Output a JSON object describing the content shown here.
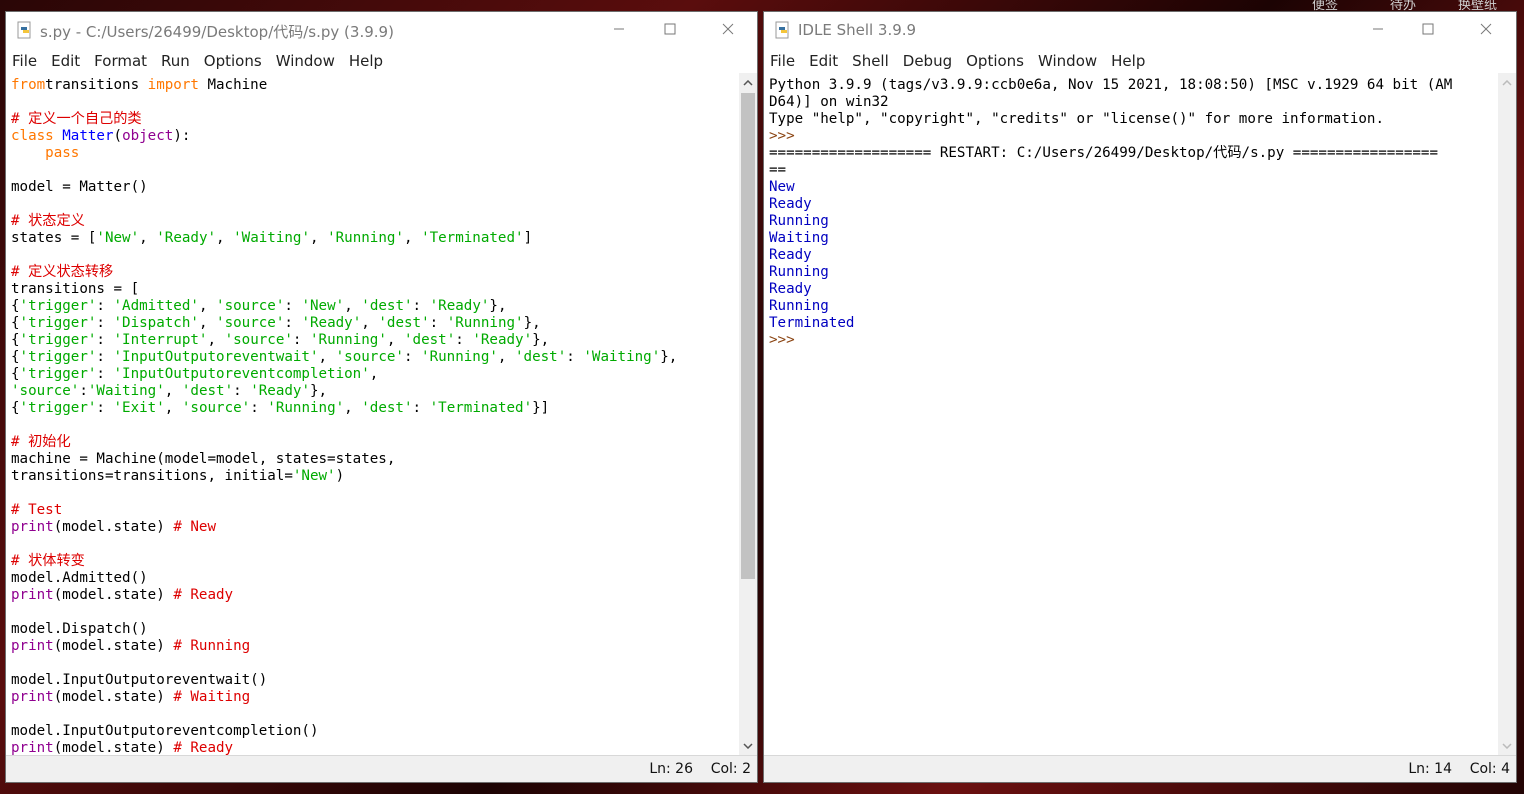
{
  "desktop": {
    "taskbar_hints": [
      "便签",
      "待办",
      "换壁纸"
    ]
  },
  "editor": {
    "title": "s.py - C:/Users/26499/Desktop/代码/s.py (3.9.9)",
    "menu": [
      "File",
      "Edit",
      "Format",
      "Run",
      "Options",
      "Window",
      "Help"
    ],
    "status": {
      "ln": "Ln: 26",
      "col": "Col: 2"
    },
    "code_lines": [
      [
        [
          "kw",
          "from"
        ],
        [
          "",
          "transitions "
        ],
        [
          "kw",
          "import"
        ],
        [
          "",
          " Machine"
        ]
      ],
      [],
      [
        [
          "cm",
          "# 定义一个自己的类"
        ]
      ],
      [
        [
          "kw",
          "class"
        ],
        [
          "",
          " "
        ],
        [
          "df",
          "Matter"
        ],
        [
          "",
          "("
        ],
        [
          "bi",
          "object"
        ],
        [
          "",
          "):"
        ]
      ],
      [
        [
          "",
          "    "
        ],
        [
          "kw",
          "pass"
        ]
      ],
      [],
      [
        [
          "",
          "model = Matter()"
        ]
      ],
      [],
      [
        [
          "cm",
          "# 状态定义"
        ]
      ],
      [
        [
          "",
          "states = ["
        ],
        [
          "st",
          "'New'"
        ],
        [
          "",
          ", "
        ],
        [
          "st",
          "'Ready'"
        ],
        [
          "",
          ", "
        ],
        [
          "st",
          "'Waiting'"
        ],
        [
          "",
          ", "
        ],
        [
          "st",
          "'Running'"
        ],
        [
          "",
          ", "
        ],
        [
          "st",
          "'Terminated'"
        ],
        [
          "",
          "]"
        ]
      ],
      [],
      [
        [
          "cm",
          "# 定义状态转移"
        ]
      ],
      [
        [
          "",
          "transitions = ["
        ]
      ],
      [
        [
          "",
          "{"
        ],
        [
          "st",
          "'trigger'"
        ],
        [
          "",
          ": "
        ],
        [
          "st",
          "'Admitted'"
        ],
        [
          "",
          ", "
        ],
        [
          "st",
          "'source'"
        ],
        [
          "",
          ": "
        ],
        [
          "st",
          "'New'"
        ],
        [
          "",
          ", "
        ],
        [
          "st",
          "'dest'"
        ],
        [
          "",
          ": "
        ],
        [
          "st",
          "'Ready'"
        ],
        [
          "",
          "},"
        ]
      ],
      [
        [
          "",
          "{"
        ],
        [
          "st",
          "'trigger'"
        ],
        [
          "",
          ": "
        ],
        [
          "st",
          "'Dispatch'"
        ],
        [
          "",
          ", "
        ],
        [
          "st",
          "'source'"
        ],
        [
          "",
          ": "
        ],
        [
          "st",
          "'Ready'"
        ],
        [
          "",
          ", "
        ],
        [
          "st",
          "'dest'"
        ],
        [
          "",
          ": "
        ],
        [
          "st",
          "'Running'"
        ],
        [
          "",
          "},"
        ]
      ],
      [
        [
          "",
          "{"
        ],
        [
          "st",
          "'trigger'"
        ],
        [
          "",
          ": "
        ],
        [
          "st",
          "'Interrupt'"
        ],
        [
          "",
          ", "
        ],
        [
          "st",
          "'source'"
        ],
        [
          "",
          ": "
        ],
        [
          "st",
          "'Running'"
        ],
        [
          "",
          ", "
        ],
        [
          "st",
          "'dest'"
        ],
        [
          "",
          ": "
        ],
        [
          "st",
          "'Ready'"
        ],
        [
          "",
          "},"
        ]
      ],
      [
        [
          "",
          "{"
        ],
        [
          "st",
          "'trigger'"
        ],
        [
          "",
          ": "
        ],
        [
          "st",
          "'InputOutputoreventwait'"
        ],
        [
          "",
          ", "
        ],
        [
          "st",
          "'source'"
        ],
        [
          "",
          ": "
        ],
        [
          "st",
          "'Running'"
        ],
        [
          "",
          ", "
        ],
        [
          "st",
          "'dest'"
        ],
        [
          "",
          ": "
        ],
        [
          "st",
          "'Waiting'"
        ],
        [
          "",
          "},"
        ]
      ],
      [
        [
          "",
          "{"
        ],
        [
          "st",
          "'trigger'"
        ],
        [
          "",
          ": "
        ],
        [
          "st",
          "'InputOutputoreventcompletion'"
        ],
        [
          "",
          ","
        ]
      ],
      [
        [
          "st",
          "'source'"
        ],
        [
          "",
          ":"
        ],
        [
          "st",
          "'Waiting'"
        ],
        [
          "",
          ", "
        ],
        [
          "st",
          "'dest'"
        ],
        [
          "",
          ": "
        ],
        [
          "st",
          "'Ready'"
        ],
        [
          "",
          "},"
        ]
      ],
      [
        [
          "",
          "{"
        ],
        [
          "st",
          "'trigger'"
        ],
        [
          "",
          ": "
        ],
        [
          "st",
          "'Exit'"
        ],
        [
          "",
          ", "
        ],
        [
          "st",
          "'source'"
        ],
        [
          "",
          ": "
        ],
        [
          "st",
          "'Running'"
        ],
        [
          "",
          ", "
        ],
        [
          "st",
          "'dest'"
        ],
        [
          "",
          ": "
        ],
        [
          "st",
          "'Terminated'"
        ],
        [
          "",
          "}]"
        ]
      ],
      [],
      [
        [
          "cm",
          "# 初始化"
        ]
      ],
      [
        [
          "",
          "machine = Machine(model=model, states=states,"
        ]
      ],
      [
        [
          "",
          "transitions=transitions, initial="
        ],
        [
          "st",
          "'New'"
        ],
        [
          "",
          ")"
        ]
      ],
      [],
      [
        [
          "cm",
          "# Test"
        ]
      ],
      [
        [
          "bi",
          "print"
        ],
        [
          "",
          "(model.state) "
        ],
        [
          "cm",
          "# New"
        ]
      ],
      [],
      [
        [
          "cm",
          "# 状体转变"
        ]
      ],
      [
        [
          "",
          "model.Admitted()"
        ]
      ],
      [
        [
          "bi",
          "print"
        ],
        [
          "",
          "(model.state) "
        ],
        [
          "cm",
          "# Ready"
        ]
      ],
      [],
      [
        [
          "",
          "model.Dispatch()"
        ]
      ],
      [
        [
          "bi",
          "print"
        ],
        [
          "",
          "(model.state) "
        ],
        [
          "cm",
          "# Running"
        ]
      ],
      [],
      [
        [
          "",
          "model.InputOutputoreventwait()"
        ]
      ],
      [
        [
          "bi",
          "print"
        ],
        [
          "",
          "(model.state) "
        ],
        [
          "cm",
          "# Waiting"
        ]
      ],
      [],
      [
        [
          "",
          "model.InputOutputoreventcompletion()"
        ]
      ],
      [
        [
          "bi",
          "print"
        ],
        [
          "",
          "(model.state) "
        ],
        [
          "cm",
          "# Ready"
        ]
      ]
    ]
  },
  "shell": {
    "title": "IDLE Shell 3.9.9",
    "menu": [
      "File",
      "Edit",
      "Shell",
      "Debug",
      "Options",
      "Window",
      "Help"
    ],
    "status": {
      "ln": "Ln: 14",
      "col": "Col: 4"
    },
    "lines": [
      [
        [
          "",
          "Python 3.9.9 (tags/v3.9.9:ccb0e6a, Nov 15 2021, 18:08:50) [MSC v.1929 64 bit (AM"
        ]
      ],
      [
        [
          "",
          "D64)] on win32"
        ]
      ],
      [
        [
          "",
          "Type \"help\", \"copyright\", \"credits\" or \"license()\" for more information."
        ]
      ],
      [
        [
          "prompt",
          ">>> "
        ]
      ],
      [
        [
          "",
          "=================== RESTART: C:/Users/26499/Desktop/代码/s.py ================="
        ]
      ],
      [
        [
          "",
          "=="
        ]
      ],
      [
        [
          "out",
          "New"
        ]
      ],
      [
        [
          "out",
          "Ready"
        ]
      ],
      [
        [
          "out",
          "Running"
        ]
      ],
      [
        [
          "out",
          "Waiting"
        ]
      ],
      [
        [
          "out",
          "Ready"
        ]
      ],
      [
        [
          "out",
          "Running"
        ]
      ],
      [
        [
          "out",
          "Ready"
        ]
      ],
      [
        [
          "out",
          "Running"
        ]
      ],
      [
        [
          "out",
          "Terminated"
        ]
      ],
      [
        [
          "prompt",
          ">>> "
        ]
      ]
    ]
  },
  "colors": {
    "keyword": "#ff7700",
    "comment": "#dd0000",
    "string": "#00aa00",
    "builtin": "#900090",
    "definition": "#0000ff",
    "stdout": "#0000c0"
  }
}
